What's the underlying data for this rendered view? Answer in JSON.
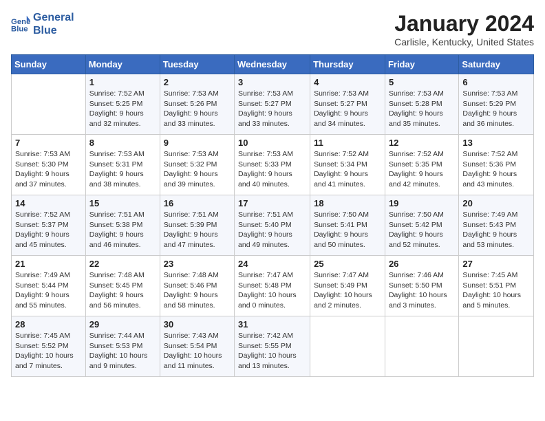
{
  "header": {
    "logo_line1": "General",
    "logo_line2": "Blue",
    "month_title": "January 2024",
    "location": "Carlisle, Kentucky, United States"
  },
  "days_of_week": [
    "Sunday",
    "Monday",
    "Tuesday",
    "Wednesday",
    "Thursday",
    "Friday",
    "Saturday"
  ],
  "weeks": [
    [
      {
        "day": "",
        "sunrise": "",
        "sunset": "",
        "daylight": ""
      },
      {
        "day": "1",
        "sunrise": "Sunrise: 7:52 AM",
        "sunset": "Sunset: 5:25 PM",
        "daylight": "Daylight: 9 hours and 32 minutes."
      },
      {
        "day": "2",
        "sunrise": "Sunrise: 7:53 AM",
        "sunset": "Sunset: 5:26 PM",
        "daylight": "Daylight: 9 hours and 33 minutes."
      },
      {
        "day": "3",
        "sunrise": "Sunrise: 7:53 AM",
        "sunset": "Sunset: 5:27 PM",
        "daylight": "Daylight: 9 hours and 33 minutes."
      },
      {
        "day": "4",
        "sunrise": "Sunrise: 7:53 AM",
        "sunset": "Sunset: 5:27 PM",
        "daylight": "Daylight: 9 hours and 34 minutes."
      },
      {
        "day": "5",
        "sunrise": "Sunrise: 7:53 AM",
        "sunset": "Sunset: 5:28 PM",
        "daylight": "Daylight: 9 hours and 35 minutes."
      },
      {
        "day": "6",
        "sunrise": "Sunrise: 7:53 AM",
        "sunset": "Sunset: 5:29 PM",
        "daylight": "Daylight: 9 hours and 36 minutes."
      }
    ],
    [
      {
        "day": "7",
        "sunrise": "Sunrise: 7:53 AM",
        "sunset": "Sunset: 5:30 PM",
        "daylight": "Daylight: 9 hours and 37 minutes."
      },
      {
        "day": "8",
        "sunrise": "Sunrise: 7:53 AM",
        "sunset": "Sunset: 5:31 PM",
        "daylight": "Daylight: 9 hours and 38 minutes."
      },
      {
        "day": "9",
        "sunrise": "Sunrise: 7:53 AM",
        "sunset": "Sunset: 5:32 PM",
        "daylight": "Daylight: 9 hours and 39 minutes."
      },
      {
        "day": "10",
        "sunrise": "Sunrise: 7:53 AM",
        "sunset": "Sunset: 5:33 PM",
        "daylight": "Daylight: 9 hours and 40 minutes."
      },
      {
        "day": "11",
        "sunrise": "Sunrise: 7:52 AM",
        "sunset": "Sunset: 5:34 PM",
        "daylight": "Daylight: 9 hours and 41 minutes."
      },
      {
        "day": "12",
        "sunrise": "Sunrise: 7:52 AM",
        "sunset": "Sunset: 5:35 PM",
        "daylight": "Daylight: 9 hours and 42 minutes."
      },
      {
        "day": "13",
        "sunrise": "Sunrise: 7:52 AM",
        "sunset": "Sunset: 5:36 PM",
        "daylight": "Daylight: 9 hours and 43 minutes."
      }
    ],
    [
      {
        "day": "14",
        "sunrise": "Sunrise: 7:52 AM",
        "sunset": "Sunset: 5:37 PM",
        "daylight": "Daylight: 9 hours and 45 minutes."
      },
      {
        "day": "15",
        "sunrise": "Sunrise: 7:51 AM",
        "sunset": "Sunset: 5:38 PM",
        "daylight": "Daylight: 9 hours and 46 minutes."
      },
      {
        "day": "16",
        "sunrise": "Sunrise: 7:51 AM",
        "sunset": "Sunset: 5:39 PM",
        "daylight": "Daylight: 9 hours and 47 minutes."
      },
      {
        "day": "17",
        "sunrise": "Sunrise: 7:51 AM",
        "sunset": "Sunset: 5:40 PM",
        "daylight": "Daylight: 9 hours and 49 minutes."
      },
      {
        "day": "18",
        "sunrise": "Sunrise: 7:50 AM",
        "sunset": "Sunset: 5:41 PM",
        "daylight": "Daylight: 9 hours and 50 minutes."
      },
      {
        "day": "19",
        "sunrise": "Sunrise: 7:50 AM",
        "sunset": "Sunset: 5:42 PM",
        "daylight": "Daylight: 9 hours and 52 minutes."
      },
      {
        "day": "20",
        "sunrise": "Sunrise: 7:49 AM",
        "sunset": "Sunset: 5:43 PM",
        "daylight": "Daylight: 9 hours and 53 minutes."
      }
    ],
    [
      {
        "day": "21",
        "sunrise": "Sunrise: 7:49 AM",
        "sunset": "Sunset: 5:44 PM",
        "daylight": "Daylight: 9 hours and 55 minutes."
      },
      {
        "day": "22",
        "sunrise": "Sunrise: 7:48 AM",
        "sunset": "Sunset: 5:45 PM",
        "daylight": "Daylight: 9 hours and 56 minutes."
      },
      {
        "day": "23",
        "sunrise": "Sunrise: 7:48 AM",
        "sunset": "Sunset: 5:46 PM",
        "daylight": "Daylight: 9 hours and 58 minutes."
      },
      {
        "day": "24",
        "sunrise": "Sunrise: 7:47 AM",
        "sunset": "Sunset: 5:48 PM",
        "daylight": "Daylight: 10 hours and 0 minutes."
      },
      {
        "day": "25",
        "sunrise": "Sunrise: 7:47 AM",
        "sunset": "Sunset: 5:49 PM",
        "daylight": "Daylight: 10 hours and 2 minutes."
      },
      {
        "day": "26",
        "sunrise": "Sunrise: 7:46 AM",
        "sunset": "Sunset: 5:50 PM",
        "daylight": "Daylight: 10 hours and 3 minutes."
      },
      {
        "day": "27",
        "sunrise": "Sunrise: 7:45 AM",
        "sunset": "Sunset: 5:51 PM",
        "daylight": "Daylight: 10 hours and 5 minutes."
      }
    ],
    [
      {
        "day": "28",
        "sunrise": "Sunrise: 7:45 AM",
        "sunset": "Sunset: 5:52 PM",
        "daylight": "Daylight: 10 hours and 7 minutes."
      },
      {
        "day": "29",
        "sunrise": "Sunrise: 7:44 AM",
        "sunset": "Sunset: 5:53 PM",
        "daylight": "Daylight: 10 hours and 9 minutes."
      },
      {
        "day": "30",
        "sunrise": "Sunrise: 7:43 AM",
        "sunset": "Sunset: 5:54 PM",
        "daylight": "Daylight: 10 hours and 11 minutes."
      },
      {
        "day": "31",
        "sunrise": "Sunrise: 7:42 AM",
        "sunset": "Sunset: 5:55 PM",
        "daylight": "Daylight: 10 hours and 13 minutes."
      },
      {
        "day": "",
        "sunrise": "",
        "sunset": "",
        "daylight": ""
      },
      {
        "day": "",
        "sunrise": "",
        "sunset": "",
        "daylight": ""
      },
      {
        "day": "",
        "sunrise": "",
        "sunset": "",
        "daylight": ""
      }
    ]
  ]
}
